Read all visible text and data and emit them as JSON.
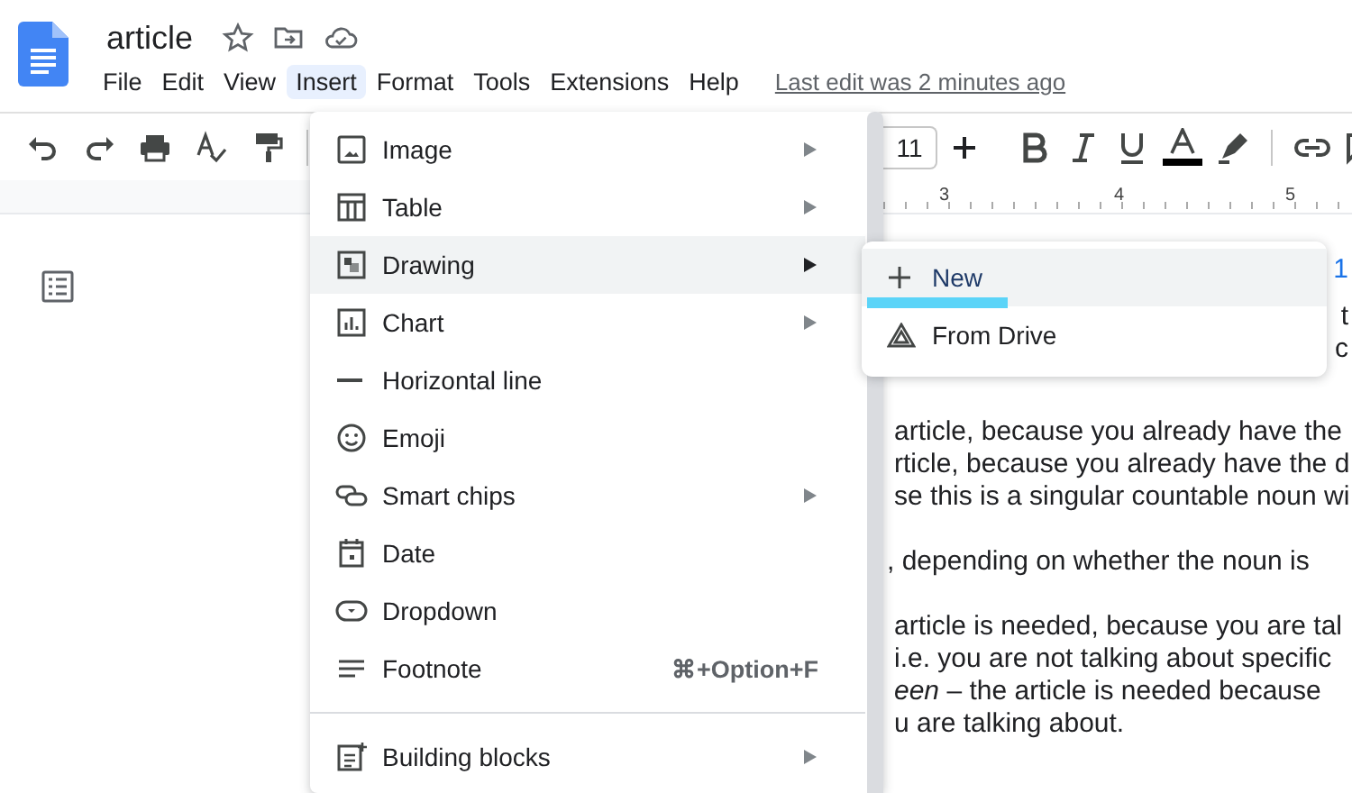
{
  "app": {
    "title": "article",
    "last_edit": "Last edit was 2 minutes ago"
  },
  "menubar": [
    {
      "label": "File",
      "selected": false
    },
    {
      "label": "Edit",
      "selected": false
    },
    {
      "label": "View",
      "selected": false
    },
    {
      "label": "Insert",
      "selected": true
    },
    {
      "label": "Format",
      "selected": false
    },
    {
      "label": "Tools",
      "selected": false
    },
    {
      "label": "Extensions",
      "selected": false
    },
    {
      "label": "Help",
      "selected": false
    }
  ],
  "toolbar": {
    "font_size": "11"
  },
  "ruler": [
    "3",
    "4",
    "5"
  ],
  "insert_menu": [
    {
      "kind": "submenu",
      "label": "Image",
      "selected": false
    },
    {
      "kind": "submenu",
      "label": "Table",
      "selected": false
    },
    {
      "kind": "submenu",
      "label": "Drawing",
      "selected": true
    },
    {
      "kind": "submenu",
      "label": "Chart",
      "selected": false
    },
    {
      "kind": "plain",
      "label": "Horizontal line",
      "selected": false
    },
    {
      "kind": "plain",
      "label": "Emoji",
      "selected": false
    },
    {
      "kind": "submenu",
      "label": "Smart chips",
      "selected": false
    },
    {
      "kind": "plain",
      "label": "Date",
      "selected": false
    },
    {
      "kind": "plain",
      "label": "Dropdown",
      "selected": false
    },
    {
      "kind": "shortcut",
      "label": "Footnote",
      "shortcut": "⌘+Option+F",
      "selected": false
    },
    {
      "kind": "divider"
    },
    {
      "kind": "submenu",
      "label": "Building blocks",
      "selected": false
    }
  ],
  "drawing_submenu": [
    {
      "label": "New",
      "selected": true
    },
    {
      "label": "From Drive",
      "selected": false
    }
  ],
  "document": {
    "edge_texts": [
      "1",
      "t",
      "c"
    ],
    "paragraphs": [
      [
        "article, because you already have the",
        "rticle, because you already have the d",
        "se this is a singular countable noun wi"
      ],
      [
        ", depending on whether the noun is"
      ],
      [
        "article is needed, because you are tal",
        "i.e. you are not talking about specific",
        "*een* – the article is needed because",
        "u are talking about."
      ]
    ]
  }
}
